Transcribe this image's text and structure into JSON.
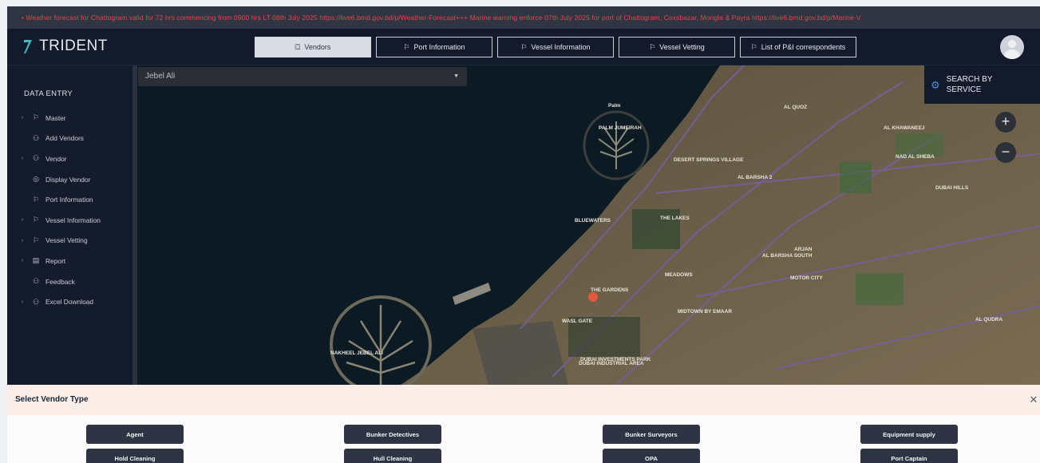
{
  "ticker": "• Weather forecast for Chattogram valid for 72 hrs commencing from 0900 hrs LT 08th July 2025 https://live6.bmd.gov.bd/p/Weather-Forecast+++ Marine warning enforce 07th July 2025 for port of Chattogram, Coxsbazar, Mongla & Payra https://live6.bmd.gov.bd/p/Marine-V",
  "header": {
    "app_name": "TRIDENT",
    "tabs": [
      {
        "label": "Vendors",
        "icon": "handshake-icon",
        "active": true
      },
      {
        "label": "Port Information",
        "icon": "flag-icon"
      },
      {
        "label": "Vessel Information",
        "icon": "flag-icon"
      },
      {
        "label": "Vessel Vetting",
        "icon": "flag-icon"
      },
      {
        "label": "List of P&I correspondents",
        "icon": "flag-icon"
      }
    ]
  },
  "sidebar": {
    "heading": "DATA ENTRY",
    "items": [
      {
        "label": "Master",
        "icon": "flag-icon",
        "expandable": true
      },
      {
        "label": "Add Vendors",
        "icon": "users-icon",
        "expandable": false
      },
      {
        "label": "Vendor",
        "icon": "users-icon",
        "expandable": true
      },
      {
        "label": "Display Vendor",
        "icon": "eye-icon",
        "expandable": false
      },
      {
        "label": "Port Information",
        "icon": "flag-icon",
        "expandable": false
      },
      {
        "label": "Vessel Information",
        "icon": "flag-icon",
        "expandable": true
      },
      {
        "label": "Vessel Vetting",
        "icon": "flag-icon",
        "expandable": true
      },
      {
        "label": "Report",
        "icon": "document-icon",
        "expandable": true
      },
      {
        "label": "Feedback",
        "icon": "users-icon",
        "expandable": false
      },
      {
        "label": "Excel Download",
        "icon": "users-icon",
        "expandable": true
      }
    ]
  },
  "map": {
    "location_value": "Jebel Ali",
    "search_by_service": "SEARCH BY SERVICE",
    "labels": [
      "Palm",
      "PALM JUMEIRAH",
      "BLUEWATERS",
      "DESERT SPRINGS VILLAGE",
      "AL BARSHA 2",
      "THE LAKES",
      "NAKHEEL JEBEL ALI",
      "THE GARDENS",
      "AL BARSHA SOUTH",
      "ARJAN",
      "DUBAI INVESTMENTS PARK",
      "DUBAI HILLS",
      "MEADOWS",
      "MOTOR CITY",
      "AL QUOZ",
      "MIDTOWN BY EMAAR",
      "WASL GATE",
      "DUBAI INDUSTRIAL AREA",
      "AL QUDRA",
      "AL KHAWANEEJ",
      "NAD AL SHEBA"
    ]
  },
  "vendor_panel": {
    "title": "Select Vendor Type",
    "buttons": [
      "Agent",
      "Bunker Detectives",
      "Bunker Surveyors",
      "Equipment supply",
      "Hold Cleaning",
      "Hull Cleaning",
      "OPA",
      "Port Captain"
    ]
  }
}
